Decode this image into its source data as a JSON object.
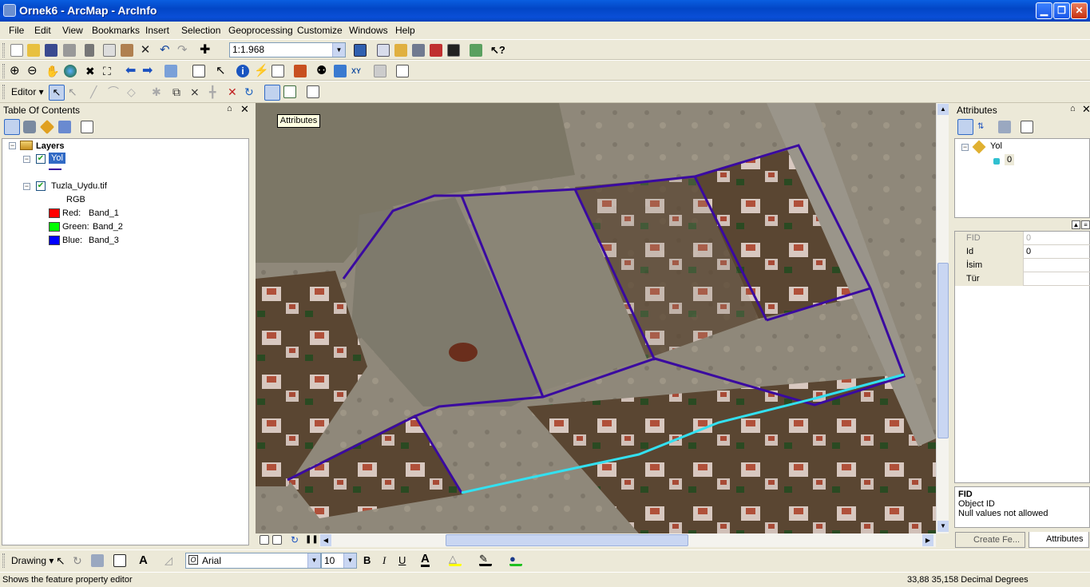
{
  "window": {
    "title": "Ornek6 - ArcMap - ArcInfo"
  },
  "menu": [
    "File",
    "Edit",
    "View",
    "Bookmarks",
    "Insert",
    "Selection",
    "Geoprocessing",
    "Customize",
    "Windows",
    "Help"
  ],
  "standard_toolbar": {
    "scale": "1:1.968"
  },
  "editor_toolbar": {
    "editor_label": "Editor ▾"
  },
  "map_tooltip": "Attributes",
  "toc": {
    "title": "Table Of Contents",
    "root": "Layers",
    "layer1": {
      "name": "Yol"
    },
    "layer2": {
      "name": "Tuzla_Uydu.tif",
      "rgb": "RGB",
      "red": "Red:",
      "red_band": "Band_1",
      "green": "Green:",
      "green_band": "Band_2",
      "blue": "Blue:",
      "blue_band": "Band_3"
    }
  },
  "attributes": {
    "title": "Attributes",
    "tree_layer": "Yol",
    "tree_feature": "0",
    "rows": [
      {
        "field": "FID",
        "value": "0"
      },
      {
        "field": "Id",
        "value": "0"
      },
      {
        "field": "İsim",
        "value": ""
      },
      {
        "field": "Tür",
        "value": ""
      }
    ],
    "desc_title": "FID",
    "desc_line1": "Object ID",
    "desc_line2": "Null values not allowed",
    "tab_create": "Create Fe...",
    "tab_attributes": "Attributes"
  },
  "drawing_toolbar": {
    "drawing_label": "Drawing ▾",
    "font": "Arial",
    "font_size": "10",
    "bold": "B",
    "italic": "I",
    "underline": "U",
    "text_tool": "A"
  },
  "status": {
    "message": "Shows the feature property editor",
    "coords": "33,88  35,158 Decimal Degrees"
  },
  "colors": {
    "road_line": "#3a0aa0",
    "selected_road": "#33e0f0",
    "title_bar": "#0a5ee0"
  }
}
